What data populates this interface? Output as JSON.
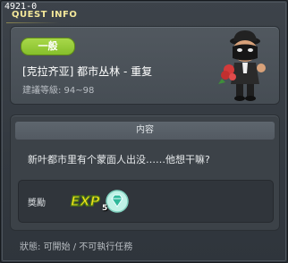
{
  "quest_id": "4921-0",
  "window_title": "QUEST INFO",
  "quest": {
    "type_badge": "一般",
    "title": "[克拉齐亚] 都市丛林 - 重复",
    "level_text": "建議等級: 94~98"
  },
  "content": {
    "header": "内容",
    "description": "新叶都市里有个蒙面人出没……他想干嘛?"
  },
  "reward": {
    "label": "獎勵",
    "exp_text": "EXP",
    "gem_count": "5"
  },
  "status_text": "狀態: 可開始 / 不可執行任務",
  "colors": {
    "badge": "#97cc35",
    "title_text": "#f3e79a"
  }
}
